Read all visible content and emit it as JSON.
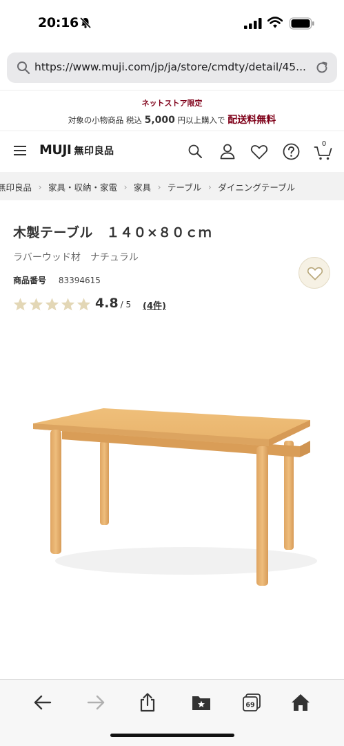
{
  "status_bar": {
    "time": "20:16"
  },
  "browser": {
    "url": "https://www.muji.com/jp/ja/store/cmdty/detail/45..."
  },
  "notice": {
    "line1": "ネットストア限定",
    "line2_prefix": "対象の小物商品 税込",
    "line2_amount": "5,000",
    "line2_suffix": "円以上購入で",
    "line2_highlight": "配送料無料"
  },
  "header": {
    "logo_text": "MUJI",
    "logo_jp": "無印良品",
    "cart_count": "0"
  },
  "breadcrumb": [
    "無印良品",
    "家具・収納・家電",
    "家具",
    "テーブル",
    "ダイニングテーブル"
  ],
  "product": {
    "title": "木製テーブル　１４０×８０ｃｍ",
    "subtitle": "ラバーウッド材　ナチュラル",
    "sku_label": "商品番号",
    "sku_value": "83394615",
    "rating_value": "4.8",
    "rating_max": "/ 5",
    "review_count": "(4件)",
    "stars_filled": 5
  },
  "colors": {
    "accent_red": "#7f0019",
    "star": "#e3d7b6",
    "fav_bg": "#f6f1e4"
  },
  "toolbar": {
    "tabs_count": "69"
  }
}
